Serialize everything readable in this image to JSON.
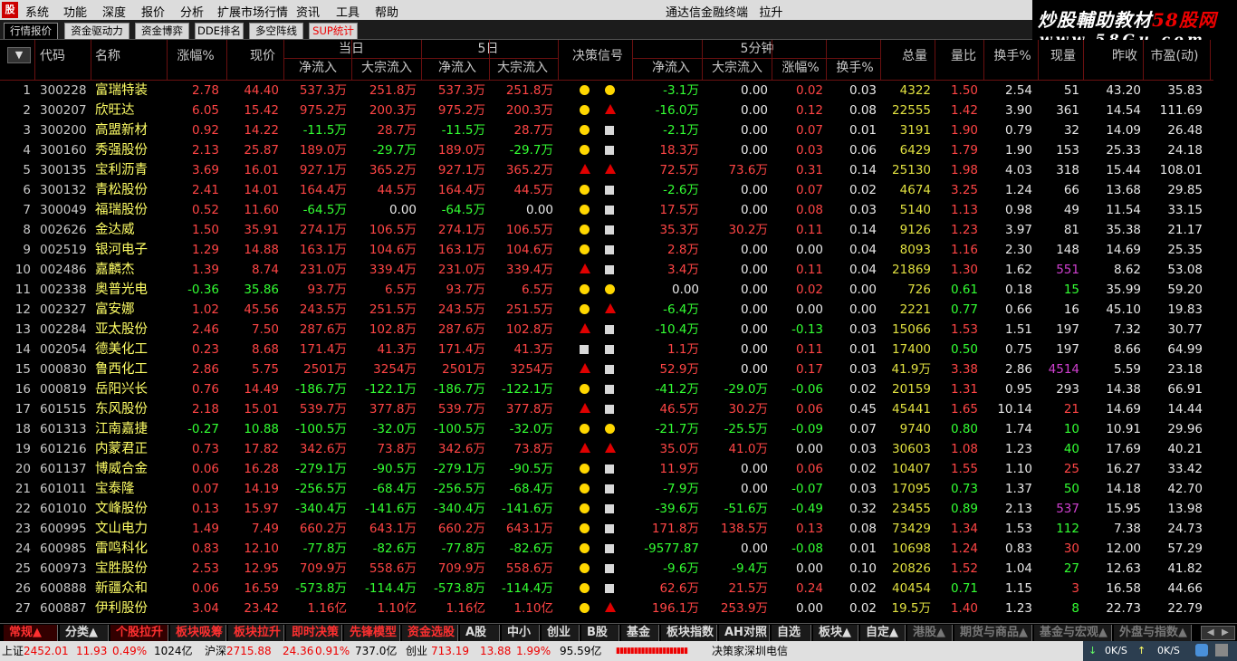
{
  "menu": {
    "logo": "股",
    "items": [
      "系统",
      "功能",
      "深度",
      "报价",
      "分析",
      "扩展市场行情",
      "资讯",
      "工具",
      "帮助"
    ],
    "app_title": "通达信金融终端",
    "app_subtitle": "拉升"
  },
  "watermark": {
    "line1_a": "炒股輔助教材",
    "line1_b": "58股网",
    "line2": "www.58Gu.com"
  },
  "tabs": [
    {
      "label": "行情报价",
      "active": true
    },
    {
      "label": "资金驱动力",
      "active": false
    },
    {
      "label": "资金博弈",
      "active": false
    },
    {
      "label": "DDE排名",
      "active": false
    },
    {
      "label": "多空阵线",
      "active": false
    },
    {
      "label": "SUP统计",
      "active": false
    }
  ],
  "header": {
    "sort_icon": "▼",
    "code": "代码",
    "name": "名称",
    "change_pct": "涨幅%",
    "price": "现价",
    "group_today": "当日",
    "group_5day": "5日",
    "signal": "决策信号",
    "group_5min": "5分钟",
    "net_inflow": "净流入",
    "block_inflow": "大宗流入",
    "change_5m": "涨幅%",
    "turnover_5m": "换手%",
    "volume": "总量",
    "vol_ratio": "量比",
    "turnover": "换手%",
    "current_vol": "现量",
    "prev_close": "昨收",
    "pe": "市盈(动)"
  },
  "rows": [
    {
      "idx": "1",
      "code": "300228",
      "name": "富瑞特装",
      "chg": "2.78",
      "price": "44.40",
      "t_net": "537.3万",
      "t_blk": "251.8万",
      "d_net": "537.3万",
      "d_blk": "251.8万",
      "sig": [
        "dot",
        "dot"
      ],
      "m_net": "-3.1万",
      "m_blk": "0.00",
      "m_chg": "0.02",
      "m_to": "0.03",
      "vol": "4322",
      "vr": "1.50",
      "to": "2.54",
      "cv": "51",
      "cvc": "wht",
      "pc": "43.20",
      "pe": "35.83"
    },
    {
      "idx": "2",
      "code": "300207",
      "name": "欣旺达",
      "chg": "6.05",
      "price": "15.42",
      "t_net": "975.2万",
      "t_blk": "200.3万",
      "d_net": "975.2万",
      "d_blk": "200.3万",
      "sig": [
        "dot",
        "tri"
      ],
      "m_net": "-16.0万",
      "m_blk": "0.00",
      "m_chg": "0.12",
      "m_to": "0.08",
      "vol": "22555",
      "vr": "1.42",
      "to": "3.90",
      "cv": "361",
      "cvc": "wht",
      "pc": "14.54",
      "pe": "111.69"
    },
    {
      "idx": "3",
      "code": "300200",
      "name": "高盟新材",
      "chg": "0.92",
      "price": "14.22",
      "t_net": "-11.5万",
      "t_blk": "28.7万",
      "d_net": "-11.5万",
      "d_blk": "28.7万",
      "sig": [
        "dot",
        "sq"
      ],
      "m_net": "-2.1万",
      "m_blk": "0.00",
      "m_chg": "0.07",
      "m_to": "0.01",
      "vol": "3191",
      "vr": "1.90",
      "to": "0.79",
      "cv": "32",
      "cvc": "wht",
      "pc": "14.09",
      "pe": "26.48"
    },
    {
      "idx": "4",
      "code": "300160",
      "name": "秀强股份",
      "chg": "2.13",
      "price": "25.87",
      "t_net": "189.0万",
      "t_blk": "-29.7万",
      "d_net": "189.0万",
      "d_blk": "-29.7万",
      "sig": [
        "dot",
        "sq"
      ],
      "m_net": "18.3万",
      "m_blk": "0.00",
      "m_chg": "0.03",
      "m_to": "0.06",
      "vol": "6429",
      "vr": "1.79",
      "to": "1.90",
      "cv": "153",
      "cvc": "wht",
      "pc": "25.33",
      "pe": "24.18"
    },
    {
      "idx": "5",
      "code": "300135",
      "name": "宝利沥青",
      "chg": "3.69",
      "price": "16.01",
      "t_net": "927.1万",
      "t_blk": "365.2万",
      "d_net": "927.1万",
      "d_blk": "365.2万",
      "sig": [
        "tri",
        "tri"
      ],
      "m_net": "72.5万",
      "m_blk": "73.6万",
      "m_chg": "0.31",
      "m_to": "0.14",
      "vol": "25130",
      "vr": "1.98",
      "to": "4.03",
      "cv": "318",
      "cvc": "wht",
      "pc": "15.44",
      "pe": "108.01"
    },
    {
      "idx": "6",
      "code": "300132",
      "name": "青松股份",
      "chg": "2.41",
      "price": "14.01",
      "t_net": "164.4万",
      "t_blk": "44.5万",
      "d_net": "164.4万",
      "d_blk": "44.5万",
      "sig": [
        "dot",
        "sq"
      ],
      "m_net": "-2.6万",
      "m_blk": "0.00",
      "m_chg": "0.07",
      "m_to": "0.02",
      "vol": "4674",
      "vr": "3.25",
      "to": "1.24",
      "cv": "66",
      "cvc": "wht",
      "pc": "13.68",
      "pe": "29.85"
    },
    {
      "idx": "7",
      "code": "300049",
      "name": "福瑞股份",
      "chg": "0.52",
      "price": "11.60",
      "t_net": "-64.5万",
      "t_blk": "0.00",
      "d_net": "-64.5万",
      "d_blk": "0.00",
      "sig": [
        "dot",
        "sq"
      ],
      "m_net": "17.5万",
      "m_blk": "0.00",
      "m_chg": "0.08",
      "m_to": "0.03",
      "vol": "5140",
      "vr": "1.13",
      "to": "0.98",
      "cv": "49",
      "cvc": "wht",
      "pc": "11.54",
      "pe": "33.15"
    },
    {
      "idx": "8",
      "code": "002626",
      "name": "金达威",
      "chg": "1.50",
      "price": "35.91",
      "t_net": "274.1万",
      "t_blk": "106.5万",
      "d_net": "274.1万",
      "d_blk": "106.5万",
      "sig": [
        "dot",
        "sq"
      ],
      "m_net": "35.3万",
      "m_blk": "30.2万",
      "m_chg": "0.11",
      "m_to": "0.14",
      "vol": "9126",
      "vr": "1.23",
      "to": "3.97",
      "cv": "81",
      "cvc": "wht",
      "pc": "35.38",
      "pe": "21.17"
    },
    {
      "idx": "9",
      "code": "002519",
      "name": "银河电子",
      "chg": "1.29",
      "price": "14.88",
      "t_net": "163.1万",
      "t_blk": "104.6万",
      "d_net": "163.1万",
      "d_blk": "104.6万",
      "sig": [
        "dot",
        "sq"
      ],
      "m_net": "2.8万",
      "m_blk": "0.00",
      "m_chg": "0.00",
      "m_to": "0.04",
      "vol": "8093",
      "vr": "1.16",
      "to": "2.30",
      "cv": "148",
      "cvc": "wht",
      "pc": "14.69",
      "pe": "25.35"
    },
    {
      "idx": "10",
      "code": "002486",
      "name": "嘉麟杰",
      "chg": "1.39",
      "price": "8.74",
      "t_net": "231.0万",
      "t_blk": "339.4万",
      "d_net": "231.0万",
      "d_blk": "339.4万",
      "sig": [
        "tri",
        "sq"
      ],
      "m_net": "3.4万",
      "m_blk": "0.00",
      "m_chg": "0.11",
      "m_to": "0.04",
      "vol": "21869",
      "vr": "1.30",
      "to": "1.62",
      "cv": "551",
      "cvc": "mag",
      "pc": "8.62",
      "pe": "53.08"
    },
    {
      "idx": "11",
      "code": "002338",
      "name": "奥普光电",
      "chg": "-0.36",
      "price": "35.86",
      "t_net": "93.7万",
      "t_blk": "6.5万",
      "d_net": "93.7万",
      "d_blk": "6.5万",
      "sig": [
        "dot",
        "dot"
      ],
      "m_net": "0.00",
      "m_blk": "0.00",
      "m_chg": "0.02",
      "m_to": "0.00",
      "vol": "726",
      "vr": "0.61",
      "to": "0.18",
      "cv": "15",
      "cvc": "grn",
      "pc": "35.99",
      "pe": "59.20"
    },
    {
      "idx": "12",
      "code": "002327",
      "name": "富安娜",
      "chg": "1.02",
      "price": "45.56",
      "t_net": "243.5万",
      "t_blk": "251.5万",
      "d_net": "243.5万",
      "d_blk": "251.5万",
      "sig": [
        "dot",
        "tri"
      ],
      "m_net": "-6.4万",
      "m_blk": "0.00",
      "m_chg": "0.00",
      "m_to": "0.00",
      "vol": "2221",
      "vr": "0.77",
      "to": "0.66",
      "cv": "16",
      "cvc": "wht",
      "pc": "45.10",
      "pe": "19.83"
    },
    {
      "idx": "13",
      "code": "002284",
      "name": "亚太股份",
      "chg": "2.46",
      "price": "7.50",
      "t_net": "287.6万",
      "t_blk": "102.8万",
      "d_net": "287.6万",
      "d_blk": "102.8万",
      "sig": [
        "tri",
        "sq"
      ],
      "m_net": "-10.4万",
      "m_blk": "0.00",
      "m_chg": "-0.13",
      "m_to": "0.03",
      "vol": "15066",
      "vr": "1.53",
      "to": "1.51",
      "cv": "197",
      "cvc": "wht",
      "pc": "7.32",
      "pe": "30.77"
    },
    {
      "idx": "14",
      "code": "002054",
      "name": "德美化工",
      "chg": "0.23",
      "price": "8.68",
      "t_net": "171.4万",
      "t_blk": "41.3万",
      "d_net": "171.4万",
      "d_blk": "41.3万",
      "sig": [
        "sq",
        "sq"
      ],
      "m_net": "1.1万",
      "m_blk": "0.00",
      "m_chg": "0.11",
      "m_to": "0.01",
      "vol": "17400",
      "vr": "0.50",
      "to": "0.75",
      "cv": "197",
      "cvc": "wht",
      "pc": "8.66",
      "pe": "64.99"
    },
    {
      "idx": "15",
      "code": "000830",
      "name": "鲁西化工",
      "chg": "2.86",
      "price": "5.75",
      "t_net": "2501万",
      "t_blk": "3254万",
      "d_net": "2501万",
      "d_blk": "3254万",
      "sig": [
        "tri",
        "sq"
      ],
      "m_net": "52.9万",
      "m_blk": "0.00",
      "m_chg": "0.17",
      "m_to": "0.03",
      "vol": "41.9万",
      "vr": "3.38",
      "to": "2.86",
      "cv": "4514",
      "cvc": "mag",
      "pc": "5.59",
      "pe": "23.18"
    },
    {
      "idx": "16",
      "code": "000819",
      "name": "岳阳兴长",
      "chg": "0.76",
      "price": "14.49",
      "t_net": "-186.7万",
      "t_blk": "-122.1万",
      "d_net": "-186.7万",
      "d_blk": "-122.1万",
      "sig": [
        "dot",
        "sq"
      ],
      "m_net": "-41.2万",
      "m_blk": "-29.0万",
      "m_chg": "-0.06",
      "m_to": "0.02",
      "vol": "20159",
      "vr": "1.31",
      "to": "0.95",
      "cv": "293",
      "cvc": "wht",
      "pc": "14.38",
      "pe": "66.91"
    },
    {
      "idx": "17",
      "code": "601515",
      "name": "东风股份",
      "chg": "2.18",
      "price": "15.01",
      "t_net": "539.7万",
      "t_blk": "377.8万",
      "d_net": "539.7万",
      "d_blk": "377.8万",
      "sig": [
        "tri",
        "sq"
      ],
      "m_net": "46.5万",
      "m_blk": "30.2万",
      "m_chg": "0.06",
      "m_to": "0.45",
      "vol": "45441",
      "vr": "1.65",
      "to": "10.14",
      "cv": "21",
      "cvc": "red",
      "pc": "14.69",
      "pe": "14.44"
    },
    {
      "idx": "18",
      "code": "601313",
      "name": "江南嘉捷",
      "chg": "-0.27",
      "price": "10.88",
      "t_net": "-100.5万",
      "t_blk": "-32.0万",
      "d_net": "-100.5万",
      "d_blk": "-32.0万",
      "sig": [
        "dot",
        "dot"
      ],
      "m_net": "-21.7万",
      "m_blk": "-25.5万",
      "m_chg": "-0.09",
      "m_to": "0.07",
      "vol": "9740",
      "vr": "0.80",
      "to": "1.74",
      "cv": "10",
      "cvc": "grn",
      "pc": "10.91",
      "pe": "29.96"
    },
    {
      "idx": "19",
      "code": "601216",
      "name": "内蒙君正",
      "chg": "0.73",
      "price": "17.82",
      "t_net": "342.6万",
      "t_blk": "73.8万",
      "d_net": "342.6万",
      "d_blk": "73.8万",
      "sig": [
        "tri",
        "tri"
      ],
      "m_net": "35.0万",
      "m_blk": "41.0万",
      "m_chg": "0.00",
      "m_to": "0.03",
      "vol": "30603",
      "vr": "1.08",
      "to": "1.23",
      "cv": "40",
      "cvc": "grn",
      "pc": "17.69",
      "pe": "40.21"
    },
    {
      "idx": "20",
      "code": "601137",
      "name": "博威合金",
      "chg": "0.06",
      "price": "16.28",
      "t_net": "-279.1万",
      "t_blk": "-90.5万",
      "d_net": "-279.1万",
      "d_blk": "-90.5万",
      "sig": [
        "dot",
        "sq"
      ],
      "m_net": "11.9万",
      "m_blk": "0.00",
      "m_chg": "0.06",
      "m_to": "0.02",
      "vol": "10407",
      "vr": "1.55",
      "to": "1.10",
      "cv": "25",
      "cvc": "red",
      "pc": "16.27",
      "pe": "33.42"
    },
    {
      "idx": "21",
      "code": "601011",
      "name": "宝泰隆",
      "chg": "0.07",
      "price": "14.19",
      "t_net": "-256.5万",
      "t_blk": "-68.4万",
      "d_net": "-256.5万",
      "d_blk": "-68.4万",
      "sig": [
        "dot",
        "sq"
      ],
      "m_net": "-7.9万",
      "m_blk": "0.00",
      "m_chg": "-0.07",
      "m_to": "0.03",
      "vol": "17095",
      "vr": "0.73",
      "to": "1.37",
      "cv": "50",
      "cvc": "grn",
      "pc": "14.18",
      "pe": "42.70"
    },
    {
      "idx": "22",
      "code": "601010",
      "name": "文峰股份",
      "chg": "0.13",
      "price": "15.97",
      "t_net": "-340.4万",
      "t_blk": "-141.6万",
      "d_net": "-340.4万",
      "d_blk": "-141.6万",
      "sig": [
        "dot",
        "sq"
      ],
      "m_net": "-39.6万",
      "m_blk": "-51.6万",
      "m_chg": "-0.49",
      "m_to": "0.32",
      "vol": "23455",
      "vr": "0.89",
      "to": "2.13",
      "cv": "537",
      "cvc": "mag",
      "pc": "15.95",
      "pe": "13.98"
    },
    {
      "idx": "23",
      "code": "600995",
      "name": "文山电力",
      "chg": "1.49",
      "price": "7.49",
      "t_net": "660.2万",
      "t_blk": "643.1万",
      "d_net": "660.2万",
      "d_blk": "643.1万",
      "sig": [
        "dot",
        "sq"
      ],
      "m_net": "171.8万",
      "m_blk": "138.5万",
      "m_chg": "0.13",
      "m_to": "0.08",
      "vol": "73429",
      "vr": "1.34",
      "to": "1.53",
      "cv": "112",
      "cvc": "grn",
      "pc": "7.38",
      "pe": "24.73"
    },
    {
      "idx": "24",
      "code": "600985",
      "name": "雷鸣科化",
      "chg": "0.83",
      "price": "12.10",
      "t_net": "-77.8万",
      "t_blk": "-82.6万",
      "d_net": "-77.8万",
      "d_blk": "-82.6万",
      "sig": [
        "dot",
        "sq"
      ],
      "m_net": "-9577.87",
      "m_blk": "0.00",
      "m_chg": "-0.08",
      "m_to": "0.01",
      "vol": "10698",
      "vr": "1.24",
      "to": "0.83",
      "cv": "30",
      "cvc": "red",
      "pc": "12.00",
      "pe": "57.29"
    },
    {
      "idx": "25",
      "code": "600973",
      "name": "宝胜股份",
      "chg": "2.53",
      "price": "12.95",
      "t_net": "709.9万",
      "t_blk": "558.6万",
      "d_net": "709.9万",
      "d_blk": "558.6万",
      "sig": [
        "dot",
        "sq"
      ],
      "m_net": "-9.6万",
      "m_blk": "-9.4万",
      "m_chg": "0.00",
      "m_to": "0.10",
      "vol": "20826",
      "vr": "1.52",
      "to": "1.04",
      "cv": "27",
      "cvc": "grn",
      "pc": "12.63",
      "pe": "41.82"
    },
    {
      "idx": "26",
      "code": "600888",
      "name": "新疆众和",
      "chg": "0.06",
      "price": "16.59",
      "t_net": "-573.8万",
      "t_blk": "-114.4万",
      "d_net": "-573.8万",
      "d_blk": "-114.4万",
      "sig": [
        "dot",
        "sq"
      ],
      "m_net": "62.6万",
      "m_blk": "21.5万",
      "m_chg": "0.24",
      "m_to": "0.02",
      "vol": "40454",
      "vr": "0.71",
      "to": "1.15",
      "cv": "3",
      "cvc": "red",
      "pc": "16.58",
      "pe": "44.66"
    },
    {
      "idx": "27",
      "code": "600887",
      "name": "伊利股份",
      "chg": "3.04",
      "price": "23.42",
      "t_net": "1.16亿",
      "t_blk": "1.10亿",
      "d_net": "1.16亿",
      "d_blk": "1.10亿",
      "sig": [
        "dot",
        "tri"
      ],
      "m_net": "196.1万",
      "m_blk": "253.9万",
      "m_chg": "0.00",
      "m_to": "0.02",
      "vol": "19.5万",
      "vr": "1.40",
      "to": "1.23",
      "cv": "8",
      "cvc": "grn",
      "pc": "22.73",
      "pe": "22.79"
    }
  ],
  "bottom_tabs": [
    {
      "label": "常规▲",
      "style": "a"
    },
    {
      "label": "分类▲",
      "style": "w"
    },
    {
      "label": "个股拉升",
      "style": "a"
    },
    {
      "label": "板块吸筹",
      "style": "r"
    },
    {
      "label": "板块拉升",
      "style": "r"
    },
    {
      "label": "即时决策",
      "style": "r"
    },
    {
      "label": "先锋模型",
      "style": "r"
    },
    {
      "label": "资金选股",
      "style": "r"
    },
    {
      "label": "A股",
      "style": "w"
    },
    {
      "label": "中小",
      "style": "w"
    },
    {
      "label": "创业",
      "style": "w"
    },
    {
      "label": "B股",
      "style": "w"
    },
    {
      "label": "基金",
      "style": "w"
    },
    {
      "label": "板块指数",
      "style": "w"
    },
    {
      "label": "AH对照",
      "style": "w"
    },
    {
      "label": "自选",
      "style": "w"
    },
    {
      "label": "板块▲",
      "style": "w"
    },
    {
      "label": "自定▲",
      "style": "w"
    },
    {
      "label": "港股▲",
      "style": "d"
    },
    {
      "label": "期货与商品▲",
      "style": "d"
    },
    {
      "label": "基金与宏观▲",
      "style": "d"
    },
    {
      "label": "外盘与指数▲",
      "style": "d"
    }
  ],
  "status": {
    "sh_label": "上证",
    "sh_val": "2452.01",
    "sh_chg": "11.93",
    "sh_pct": "0.49%",
    "sh_amt": "1024亿",
    "hs_label": "沪深",
    "hs_val": "2715.88",
    "hs_chg": "24.36",
    "hs_pct": "0.91%",
    "hs_amt": "737.0亿",
    "cy_label": "创业",
    "cy_val": "713.19",
    "cy_chg": "13.88",
    "cy_pct": "1.99%",
    "cy_amt": "95.59亿",
    "bars": "▮▮▮▮▮▮▮▮▮▮▮▮▮▮▮▮▮▮▮▮",
    "server": "决策家深圳电信",
    "down_speed": "0K/S",
    "up_speed": "0K/S"
  }
}
